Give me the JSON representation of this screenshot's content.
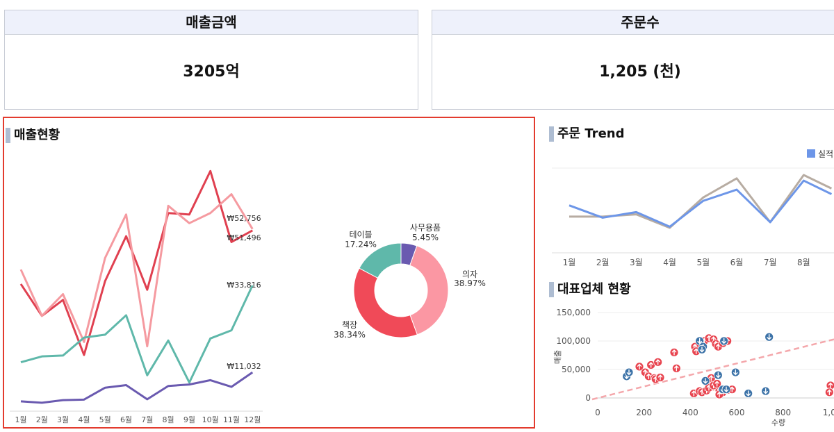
{
  "kpis": [
    {
      "title": "매출금액",
      "value": "3205억"
    },
    {
      "title": "주문수",
      "value": "1,205 (천)"
    }
  ],
  "panels": {
    "sales": "매출현황",
    "order_trend": "주문 Trend",
    "vendors": "대표업체 현황"
  },
  "colors": {
    "accent_red": "#e33b2e",
    "title_bar": "#aebdd2"
  },
  "chart_data": [
    {
      "type": "line",
      "categories": [
        "1월",
        "2월",
        "3월",
        "4월",
        "5월",
        "6월",
        "7월",
        "8월",
        "9월",
        "10월",
        "11월",
        "12월"
      ],
      "series": [
        {
          "name": "",
          "color": "#e04050",
          "values": [
            39500,
            28500,
            34000,
            15000,
            40500,
            56000,
            37500,
            64000,
            63500,
            78500,
            54000,
            58000
          ],
          "end_label": "₩51,496"
        },
        {
          "name": "",
          "color": "#f59aa0",
          "values": [
            44500,
            28500,
            36000,
            19500,
            48500,
            63500,
            18000,
            66500,
            60500,
            64000,
            70500,
            58500
          ],
          "end_label": "₩52,756"
        },
        {
          "name": "",
          "color": "#5fb8aa",
          "values": [
            12500,
            14500,
            14800,
            21000,
            22000,
            28700,
            8000,
            20000,
            5500,
            20700,
            23500,
            39000
          ],
          "end_label": "₩33,816"
        },
        {
          "name": "",
          "color": "#6a5ab0",
          "values": [
            -1000,
            -1500,
            -600,
            -400,
            3700,
            4600,
            -300,
            4300,
            4800,
            6300,
            4000,
            9000
          ],
          "end_label": "₩11,032"
        }
      ]
    },
    {
      "type": "pie",
      "slices": [
        {
          "label": "사무용품",
          "pct": "5.45%",
          "value": 5.45,
          "color": "#6a5ab0"
        },
        {
          "label": "의자",
          "pct": "38.97%",
          "value": 38.97,
          "color": "#fb97a3"
        },
        {
          "label": "책장",
          "pct": "38.34%",
          "value": 38.34,
          "color": "#f04a58"
        },
        {
          "label": "테이블",
          "pct": "17.24%",
          "value": 17.24,
          "color": "#5fb8aa"
        }
      ]
    },
    {
      "type": "line",
      "categories": [
        "1월",
        "2월",
        "3월",
        "4월",
        "5월",
        "6월",
        "7월",
        "8월"
      ],
      "legend": "실적",
      "series": [
        {
          "name": "실적",
          "color": "#6d96e8",
          "values": [
            58,
            47,
            52,
            39,
            62,
            72,
            43,
            80
          ]
        },
        {
          "name": "",
          "color": "#b7aca2",
          "values": [
            48,
            48,
            50,
            38,
            65,
            82,
            43,
            85
          ]
        }
      ]
    },
    {
      "type": "scatter",
      "xlabel": "수량",
      "ylabel": "매출",
      "x_ticks": [
        "0",
        "200",
        "400",
        "600",
        "800",
        "1,0"
      ],
      "y_ticks": [
        "0",
        "50,000",
        "100,000",
        "150,000"
      ],
      "xlim": [
        0,
        1020
      ],
      "ylim": [
        0,
        150000
      ],
      "trend": {
        "color": "#f4a7ab",
        "from": [
          0,
          0
        ],
        "to": [
          1020,
          103000
        ]
      },
      "up_color": "#e8444f",
      "down_color": "#3d73a8",
      "up_points": [
        [
          180,
          55000
        ],
        [
          205,
          45000
        ],
        [
          220,
          38000
        ],
        [
          245,
          35000
        ],
        [
          230,
          58000
        ],
        [
          260,
          63000
        ],
        [
          250,
          33000
        ],
        [
          270,
          36000
        ],
        [
          330,
          80000
        ],
        [
          340,
          52000
        ],
        [
          420,
          90000
        ],
        [
          425,
          82000
        ],
        [
          460,
          100000
        ],
        [
          480,
          105000
        ],
        [
          500,
          103000
        ],
        [
          510,
          95000
        ],
        [
          520,
          90000
        ],
        [
          540,
          96000
        ],
        [
          560,
          100000
        ],
        [
          470,
          28000
        ],
        [
          490,
          35000
        ],
        [
          500,
          20000
        ],
        [
          520,
          18000
        ],
        [
          525,
          14000
        ],
        [
          540,
          10000
        ],
        [
          560,
          14000
        ],
        [
          580,
          15000
        ],
        [
          415,
          8000
        ],
        [
          440,
          12000
        ],
        [
          450,
          10000
        ],
        [
          470,
          13000
        ],
        [
          480,
          18000
        ],
        [
          500,
          22000
        ],
        [
          515,
          25000
        ],
        [
          525,
          6000
        ],
        [
          1005,
          22000
        ],
        [
          1000,
          10000
        ]
      ],
      "down_points": [
        [
          125,
          38000
        ],
        [
          135,
          45000
        ],
        [
          440,
          100000
        ],
        [
          455,
          90000
        ],
        [
          450,
          85000
        ],
        [
          520,
          40000
        ],
        [
          465,
          30000
        ],
        [
          545,
          100000
        ],
        [
          595,
          45000
        ],
        [
          650,
          8000
        ],
        [
          725,
          12000
        ],
        [
          740,
          107000
        ],
        [
          540,
          15000
        ],
        [
          555,
          15000
        ]
      ]
    }
  ]
}
